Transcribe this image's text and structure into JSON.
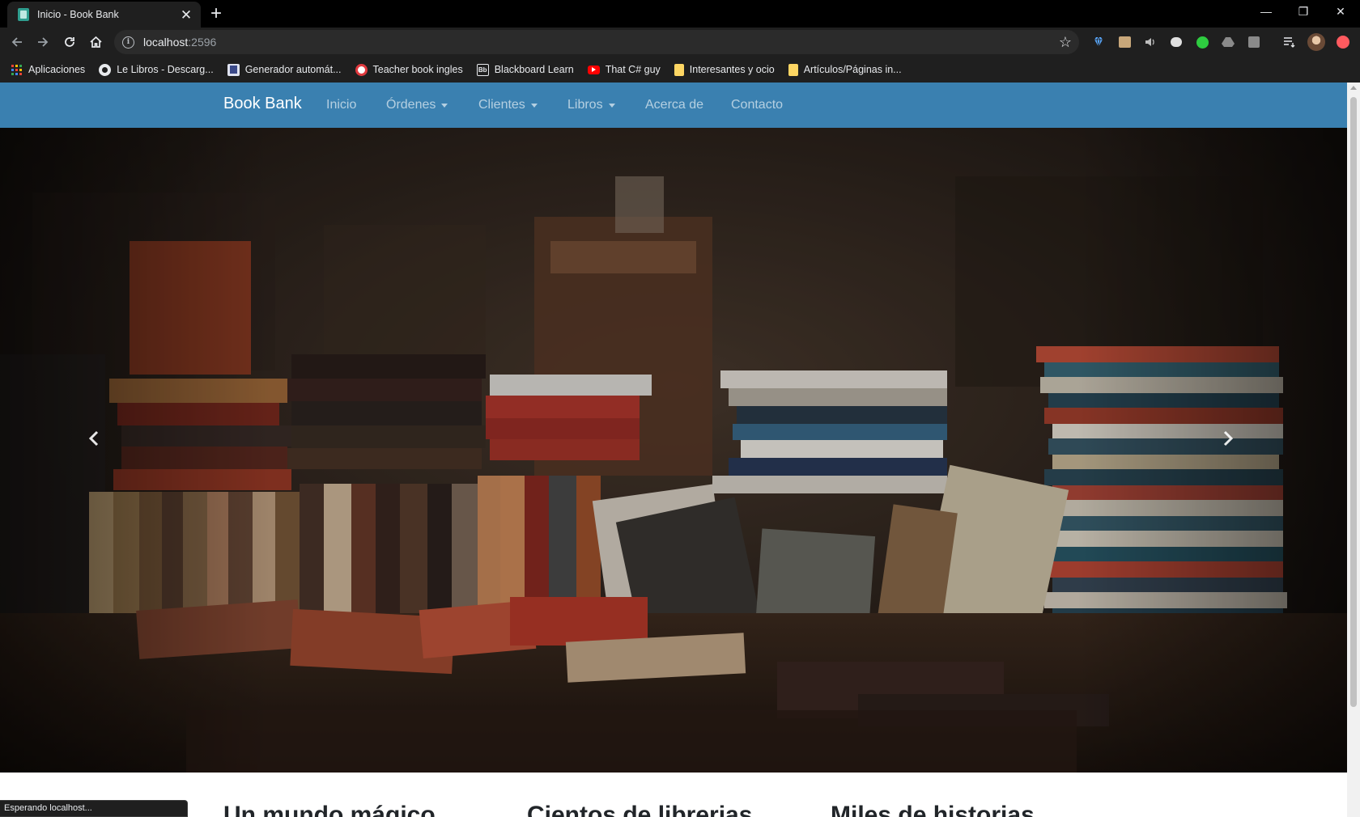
{
  "browser": {
    "tab_title": "Inicio - Book Bank",
    "url_host": "localhost",
    "url_port": ":2596",
    "status_text": "Esperando localhost...",
    "bookmarks": [
      {
        "label": "Aplicaciones",
        "icon": "apps-grid-icon"
      },
      {
        "label": "Le Libros - Descarg...",
        "icon": "globe-icon"
      },
      {
        "label": "Generador automát...",
        "icon": "document-icon"
      },
      {
        "label": "Teacher book ingles",
        "icon": "target-icon"
      },
      {
        "label": "Blackboard Learn",
        "icon": "blackboard-icon"
      },
      {
        "label": "That C# guy",
        "icon": "youtube-icon"
      },
      {
        "label": "Interesantes y ocio",
        "icon": "folder-icon"
      },
      {
        "label": "Artículos/Páginas in...",
        "icon": "folder-icon"
      }
    ]
  },
  "site": {
    "brand": "Book Bank",
    "nav": [
      {
        "label": "Inicio",
        "dropdown": false
      },
      {
        "label": "Órdenes",
        "dropdown": true
      },
      {
        "label": "Clientes",
        "dropdown": true
      },
      {
        "label": "Libros",
        "dropdown": true
      },
      {
        "label": "Acerca de",
        "dropdown": false
      },
      {
        "label": "Contacto",
        "dropdown": false
      }
    ],
    "navbar_color": "#3a80b0",
    "features": [
      "Un mundo mágico",
      "Cientos de librerias",
      "Miles de historias"
    ]
  }
}
